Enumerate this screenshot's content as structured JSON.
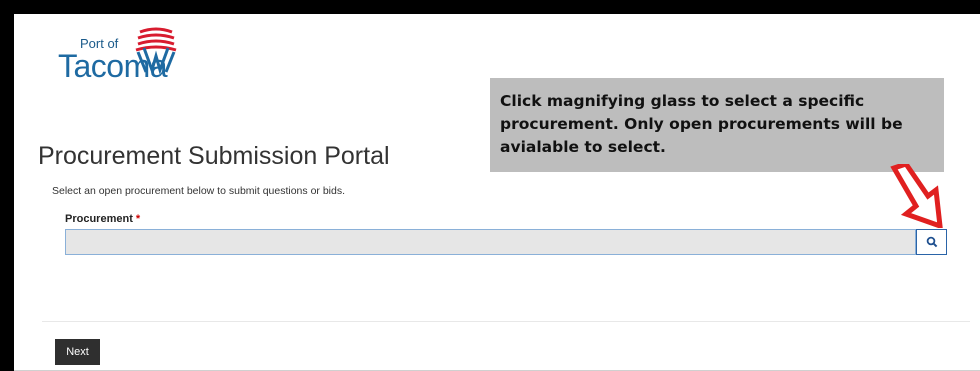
{
  "logo": {
    "small_text": "Port of",
    "big_text": "Tacoma"
  },
  "callout": {
    "text": "Click magnifying glass to select a specific procurement. Only open procurements will be avialable to select."
  },
  "page": {
    "title": "Procurement Submission Portal",
    "subtitle": "Select an open procurement below to submit questions or bids."
  },
  "procurement": {
    "label": "Procurement",
    "required_marker": "*",
    "value": "",
    "placeholder": ""
  },
  "search": {
    "icon": "search-icon"
  },
  "actions": {
    "next_label": "Next"
  },
  "colors": {
    "brand_blue": "#1e6aa2",
    "brand_red": "#d81c2f",
    "callout_bg": "#bdbdbd",
    "arrow": "#e02020"
  }
}
